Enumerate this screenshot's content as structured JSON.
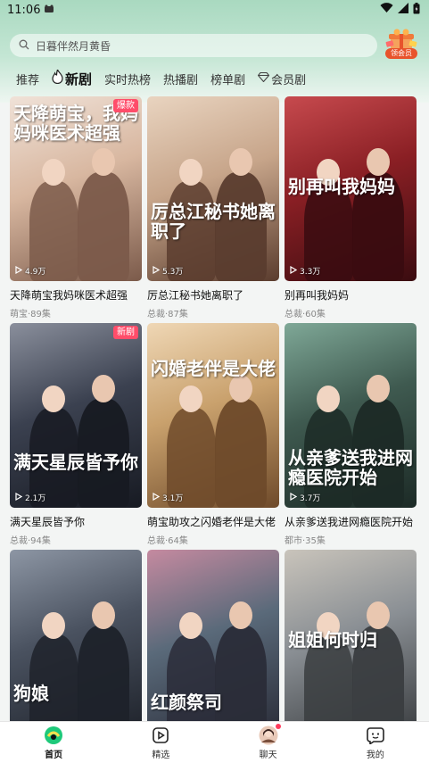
{
  "status_bar": {
    "time": "11:06"
  },
  "search": {
    "placeholder": "日暮伴然月黄昏"
  },
  "vip": {
    "label": "领会员"
  },
  "tabs": [
    {
      "label": "推荐"
    },
    {
      "label": "新剧"
    },
    {
      "label": "实时热榜"
    },
    {
      "label": "热播剧"
    },
    {
      "label": "榜单剧"
    },
    {
      "label": "会员剧"
    }
  ],
  "cards": [
    {
      "poster_text": "天降萌宝，我妈妈咪医术超强",
      "title": "天降萌宝我妈咪医术超强",
      "meta": "萌宝·89集",
      "plays": "4.9万",
      "tag": "爆款",
      "colors": [
        "#d8b7a0",
        "#7b5a4a",
        "#f0e2d8"
      ]
    },
    {
      "poster_text": "厉总江秘书她离职了",
      "title": "厉总江秘书她离职了",
      "meta": "总裁·87集",
      "plays": "5.3万",
      "tag": "",
      "colors": [
        "#c7a58a",
        "#5a3c2e",
        "#e9d4c0"
      ]
    },
    {
      "poster_text": "别再叫我妈妈",
      "title": "别再叫我妈妈",
      "meta": "总裁·60集",
      "plays": "3.3万",
      "tag": "",
      "colors": [
        "#8a1f24",
        "#3a0c10",
        "#c74a4e"
      ]
    },
    {
      "poster_text": "满天星辰皆予你",
      "title": "满天星辰皆予你",
      "meta": "总裁·94集",
      "plays": "2.1万",
      "tag": "新剧",
      "colors": [
        "#3b4150",
        "#171a22",
        "#8a8f9c"
      ]
    },
    {
      "poster_text": "闪婚老伴是大佬",
      "title": "萌宝助攻之闪婚老伴是大佬",
      "meta": "总裁·64集",
      "plays": "3.1万",
      "tag": "",
      "colors": [
        "#c9a16d",
        "#6e4a2a",
        "#efd7b5"
      ]
    },
    {
      "poster_text": "从亲爹送我进网瘾医院开始",
      "title": "从亲爹送我进网瘾医院开始",
      "meta": "都市·35集",
      "plays": "3.7万",
      "tag": "",
      "colors": [
        "#3f5a50",
        "#1c2a26",
        "#7fa897"
      ]
    },
    {
      "poster_text": "狗娘",
      "title": "",
      "meta": "",
      "plays": "",
      "tag": "",
      "colors": [
        "#4a5260",
        "#1e222a",
        "#8d96a4"
      ]
    },
    {
      "poster_text": "红颜祭司",
      "title": "",
      "meta": "",
      "plays": "",
      "tag": "",
      "colors": [
        "#5a6a7a",
        "#2a2c38",
        "#c58aa0"
      ]
    },
    {
      "poster_text": "姐姐何时归",
      "title": "",
      "meta": "",
      "plays": "",
      "tag": "",
      "colors": [
        "#8a8f94",
        "#3a3d40",
        "#c9c4bb"
      ]
    }
  ],
  "bottom_nav": [
    {
      "label": "首页",
      "icon": "home-logo-icon",
      "active": true
    },
    {
      "label": "精选",
      "icon": "play-square-icon",
      "active": false
    },
    {
      "label": "聊天",
      "icon": "avatar-icon",
      "active": false
    },
    {
      "label": "我的",
      "icon": "smile-chat-icon",
      "active": false
    }
  ]
}
